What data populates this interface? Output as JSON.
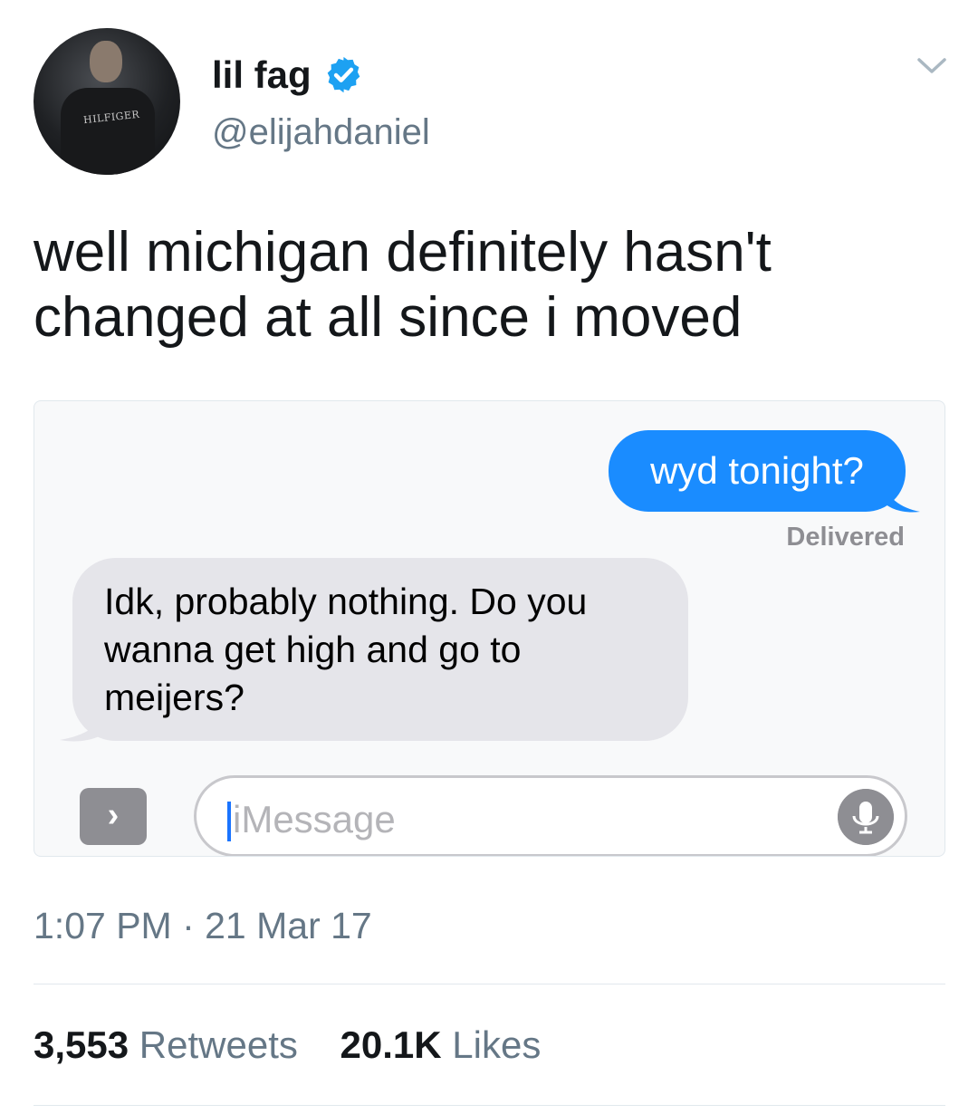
{
  "tweet": {
    "display_name": "lil fag",
    "handle": "@elijahdaniel",
    "verified": true,
    "text": "well michigan definitely hasn't changed at all since i moved",
    "avatar_shirt_text": "HILFIGER",
    "timestamp": "1:07 PM · 21 Mar 17"
  },
  "media": {
    "sent_message": "wyd tonight?",
    "sent_status": "Delivered",
    "received_message": "Idk, probably nothing. Do you wanna get high and go to meijers?",
    "input_placeholder": "iMessage",
    "apps_button_glyph": "›",
    "mic_icon": "microphone-icon"
  },
  "stats": {
    "retweets_count": "3,553",
    "retweets_label": "Retweets",
    "likes_count": "20.1K",
    "likes_label": "Likes"
  },
  "colors": {
    "imessage_blue": "#1a8cff",
    "received_gray": "#e5e5ea",
    "verified_blue": "#1da1f2",
    "secondary_text": "#657786"
  }
}
